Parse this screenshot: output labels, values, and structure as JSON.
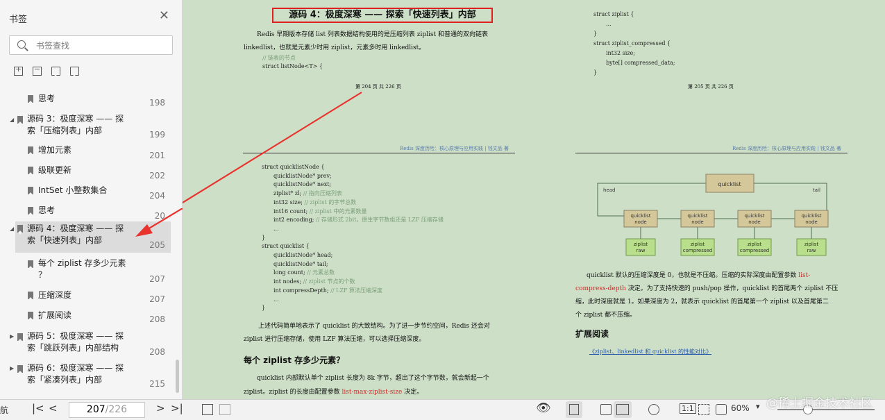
{
  "sidebar": {
    "title": "书签",
    "search_placeholder": "书签查找",
    "items": [
      {
        "label": "思考",
        "page": "198"
      },
      {
        "label": "源码 3：极度深寒 —— 探",
        "label2": "索「压缩列表」内部",
        "page": "199"
      },
      {
        "label": "增加元素",
        "page": "201"
      },
      {
        "label": "级联更新",
        "page": "202"
      },
      {
        "label": "IntSet 小整数集合",
        "page": "204"
      },
      {
        "label": "思考",
        "page": "20"
      },
      {
        "label": "源码 4：极度深寒 —— 探",
        "label2": "索「快速列表」内部",
        "page": "205"
      },
      {
        "label": "每个 ziplist 存多少元素",
        "label2": "？",
        "page": "207"
      },
      {
        "label": "压缩深度",
        "page": "207"
      },
      {
        "label": "扩展阅读",
        "page": "208"
      },
      {
        "label": "源码 5：极度深寒 —— 探",
        "label2": "索「跳跃列表」内部结构",
        "page": "208"
      },
      {
        "label": "源码 6：极度深寒 —— 探",
        "label2": "索「紧凑列表」内部",
        "page": "215"
      }
    ]
  },
  "page_left_top": {
    "title": "源码 4：极度深寒 —— 探索「快速列表」内部",
    "para1": "Redis 早期版本存储 list 列表数据结构使用的是压缩列表 ziplist 和普通的双向链表",
    "para2": "linkedlist，也就是元素少时用 ziplist，元素多时用 linkedlist。",
    "code_comment": "// 链表的节点",
    "code_line": "struct listNode<T> {",
    "footer": "第 204 页 共 226 页"
  },
  "page_right_top": {
    "lines": [
      "struct ziplist {",
      "...",
      "}",
      "struct ziplist_compressed {",
      "int32 size;",
      "byte[] compressed_data;",
      "}"
    ],
    "footer": "第 205 页 共 226 页"
  },
  "running_header": "Redis 深度历险：核心原理与应用实践  |  钱文品 著",
  "page_left_bottom": {
    "code": [
      {
        "t": "struct quicklistNode {",
        "c": "",
        "i": 0
      },
      {
        "t": "quicklistNode* prev;",
        "c": "",
        "i": 1
      },
      {
        "t": "quicklistNode* next;",
        "c": "",
        "i": 1
      },
      {
        "t": "ziplist* zl; ",
        "c": "// 指向压缩列表",
        "i": 1
      },
      {
        "t": "int32 size; ",
        "c": "// ziplist 的字节总数",
        "i": 1
      },
      {
        "t": "int16 count; ",
        "c": "// ziplist 中的元素数量",
        "i": 1
      },
      {
        "t": "int2 encoding; ",
        "c": "// 存储形式 2bit，原生字节数组还是 LZF 压缩存储",
        "i": 1
      },
      {
        "t": "...",
        "c": "",
        "i": 1
      },
      {
        "t": "}",
        "c": "",
        "i": 0
      },
      {
        "t": "struct quicklist {",
        "c": "",
        "i": 0
      },
      {
        "t": "quicklistNode* head;",
        "c": "",
        "i": 1
      },
      {
        "t": "quicklistNode* tail;",
        "c": "",
        "i": 1
      },
      {
        "t": "long count; ",
        "c": "// 元素总数",
        "i": 1
      },
      {
        "t": "int nodes; ",
        "c": "// ziplist 节点的个数",
        "i": 1
      },
      {
        "t": "int compressDepth; ",
        "c": "// LZF 算法压缩深度",
        "i": 1
      },
      {
        "t": "...",
        "c": "",
        "i": 1
      },
      {
        "t": "}",
        "c": "",
        "i": 0
      }
    ],
    "para1": "上述代码简单地表示了 quicklist 的大致结构。为了进一步节约空间，Redis 还会对",
    "para2": "ziplist 进行压缩存储，使用 LZF 算法压缩，可以选择压缩深度。",
    "heading": "每个 ziplist 存多少元素？",
    "para3": "quicklist 内部默认单个 ziplist 长度为 8k 字节，超出了这个字节数，就会新起一个",
    "para4a": "ziplist。ziplist 的长度由配置参数 ",
    "para4b": "list-max-ziplist-size",
    "para4c": " 决定。"
  },
  "page_right_bottom": {
    "diagram": {
      "top": "quicklist",
      "head": "head",
      "tail": "tail",
      "node": "quicklist",
      "node2": "node",
      "raw1": "ziplist",
      "raw2": "raw",
      "comp1": "ziplist",
      "comp2": "compressed"
    },
    "p1a": "quicklist 默认的压缩深度是 0，也就是不压缩。压缩的实际深度由配置参数 ",
    "p1b": "list-",
    "p2a": "compress-depth",
    "p2b": " 决定。为了支持快速的 push/pop 操作，quicklist 的首尾两个 ziplist 不压",
    "p3": "缩，此时深度就是 1。如果深度为 2，就表示 quicklist 的首尾第一个 ziplist 以及首尾第二",
    "p4": "个 ziplist 都不压缩。",
    "heading": "扩展阅读",
    "link": "《ziplist、linkedlist 和 quicklist 的性能对比》"
  },
  "footer": {
    "nav_label": "航",
    "page_current": "207",
    "page_total": "/226",
    "zoom": "60%",
    "watermark": "@稀土掘金技术社区"
  },
  "colors": {
    "highlight_box": "#e02020",
    "arrow": "#e8332f",
    "page_bg": "#cde0c7",
    "node_fill": "#d4c79a",
    "ziplist_fill": "#b9df8c"
  }
}
